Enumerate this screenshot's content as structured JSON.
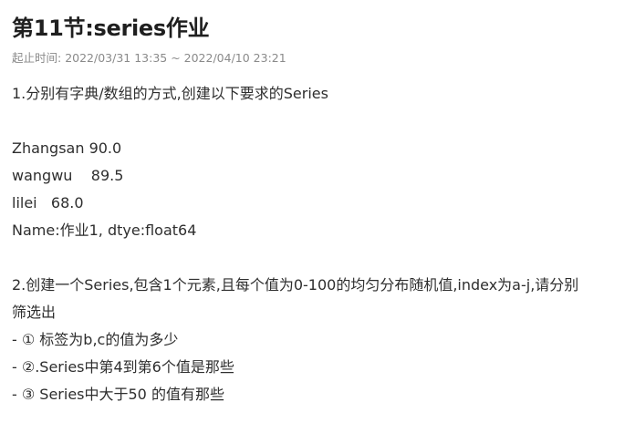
{
  "assignment": {
    "title": "第11节:series作业",
    "time_label": "起止时间: ",
    "time_range": "2022/03/31 13:35 ~ 2022/04/10 23:21"
  },
  "content": {
    "q1_title": "1.分别有字典/数组的方式,创建以下要求的Series",
    "q1_row1": "Zhangsan 90.0",
    "q1_row2": "wangwu    89.5",
    "q1_row3": "lilei   68.0",
    "q1_row4": "Name:作业1, dtye:float64",
    "q2_title_line1": "2.创建一个Series,包含1个元素,且每个值为0-100的均匀分布随机值,index为a-j,请分别",
    "q2_title_line2": "筛选出",
    "q2_item1": "- ① 标签为b,c的值为多少",
    "q2_item2": "- ②.Series中第4到第6个值是那些",
    "q2_item3": "- ③ Series中大于50 的值有那些"
  }
}
